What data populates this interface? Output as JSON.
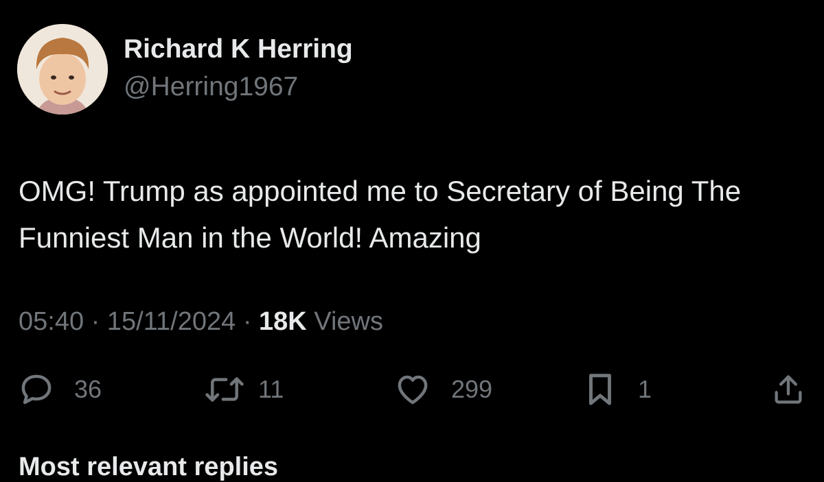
{
  "author": {
    "display_name": "Richard K Herring",
    "handle": "@Herring1967"
  },
  "tweet": {
    "text": "OMG! Trump as appointed me to Secretary of Being The Funniest Man in the World! Amazing",
    "time": "05:40",
    "separator": "·",
    "date": "15/11/2024",
    "views_count": "18K",
    "views_label": "Views"
  },
  "actions": {
    "reply": {
      "icon": "reply-icon",
      "count": "36"
    },
    "repost": {
      "icon": "repost-icon",
      "count": "11"
    },
    "like": {
      "icon": "heart-icon",
      "count": "299"
    },
    "bookmark": {
      "icon": "bookmark-icon",
      "count": "1"
    },
    "share": {
      "icon": "share-icon"
    }
  },
  "next_section": {
    "label": "Most relevant replies"
  },
  "colors": {
    "background": "#000000",
    "primary_text": "#e7e9ea",
    "secondary_text": "#71767b"
  }
}
